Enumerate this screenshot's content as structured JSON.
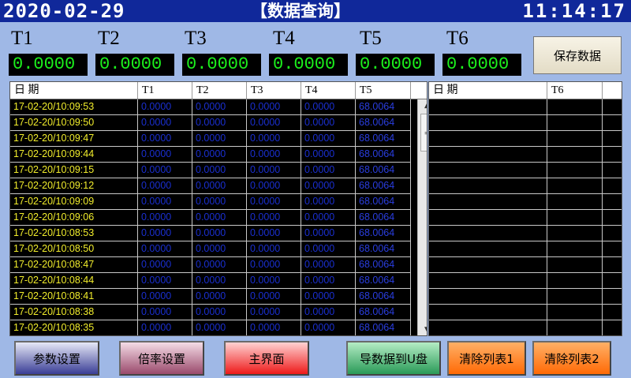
{
  "header": {
    "date": "2020-02-29",
    "title": "【数据查询】",
    "time": "11:14:17"
  },
  "temps": [
    {
      "label": "T1",
      "value": "0.0000"
    },
    {
      "label": "T2",
      "value": "0.0000"
    },
    {
      "label": "T3",
      "value": "0.0000"
    },
    {
      "label": "T4",
      "value": "0.0000"
    },
    {
      "label": "T5",
      "value": "0.0000"
    },
    {
      "label": "T6",
      "value": "0.0000"
    }
  ],
  "save_label": "保存数据",
  "table1": {
    "headers": [
      "日 期",
      "T1",
      "T2",
      "T3",
      "T4",
      "T5"
    ],
    "rows": [
      [
        "17-02-20/10:09:53",
        "0.0000",
        "0.0000",
        "0.0000",
        "0.0000",
        "68.0064"
      ],
      [
        "17-02-20/10:09:50",
        "0.0000",
        "0.0000",
        "0.0000",
        "0.0000",
        "68.0064"
      ],
      [
        "17-02-20/10:09:47",
        "0.0000",
        "0.0000",
        "0.0000",
        "0.0000",
        "68.0064"
      ],
      [
        "17-02-20/10:09:44",
        "0.0000",
        "0.0000",
        "0.0000",
        "0.0000",
        "68.0064"
      ],
      [
        "17-02-20/10:09:15",
        "0.0000",
        "0.0000",
        "0.0000",
        "0.0000",
        "68.0064"
      ],
      [
        "17-02-20/10:09:12",
        "0.0000",
        "0.0000",
        "0.0000",
        "0.0000",
        "68.0064"
      ],
      [
        "17-02-20/10:09:09",
        "0.0000",
        "0.0000",
        "0.0000",
        "0.0000",
        "68.0064"
      ],
      [
        "17-02-20/10:09:06",
        "0.0000",
        "0.0000",
        "0.0000",
        "0.0000",
        "68.0064"
      ],
      [
        "17-02-20/10:08:53",
        "0.0000",
        "0.0000",
        "0.0000",
        "0.0000",
        "68.0064"
      ],
      [
        "17-02-20/10:08:50",
        "0.0000",
        "0.0000",
        "0.0000",
        "0.0000",
        "68.0064"
      ],
      [
        "17-02-20/10:08:47",
        "0.0000",
        "0.0000",
        "0.0000",
        "0.0000",
        "68.0064"
      ],
      [
        "17-02-20/10:08:44",
        "0.0000",
        "0.0000",
        "0.0000",
        "0.0000",
        "68.0064"
      ],
      [
        "17-02-20/10:08:41",
        "0.0000",
        "0.0000",
        "0.0000",
        "0.0000",
        "68.0064"
      ],
      [
        "17-02-20/10:08:38",
        "0.0000",
        "0.0000",
        "0.0000",
        "0.0000",
        "68.0064"
      ],
      [
        "17-02-20/10:08:35",
        "0.0000",
        "0.0000",
        "0.0000",
        "0.0000",
        "68.0064"
      ]
    ]
  },
  "table2": {
    "headers": [
      "日 期",
      "T6",
      ""
    ],
    "row_count": 15
  },
  "buttons": [
    {
      "label": "参数设置",
      "bg": "linear-gradient(#e6e8f6,#3a3e96)"
    },
    {
      "label": "倍率设置",
      "bg": "linear-gradient(#f4dce6,#9a4a6c)"
    },
    {
      "label": "主界面",
      "bg": "linear-gradient(#ffd2d2,#ee1a1a)"
    },
    {
      "label": "导数据到U盘",
      "bg": "linear-gradient(#b4ecc4,#2a9a58)"
    },
    {
      "label": "清除列表1",
      "bg": "linear-gradient(#ffb066,#ff6a06)"
    },
    {
      "label": "清除列表2",
      "bg": "linear-gradient(#ffb066,#ff6a06)"
    }
  ]
}
